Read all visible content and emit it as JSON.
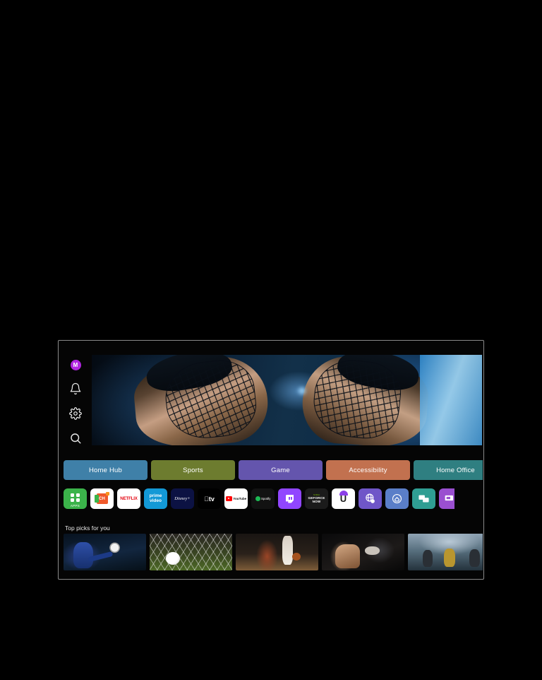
{
  "screen": {
    "device": "Smart TV Home Screen",
    "background_color": "#000000",
    "bezel_color": "#8c8c8c"
  },
  "sidebar": {
    "items": [
      {
        "name": "profile-avatar",
        "label": "M",
        "icon": "avatar-icon",
        "color": "#b026e0"
      },
      {
        "name": "notifications",
        "label": "",
        "icon": "bell-icon",
        "color": "#e6e6e6"
      },
      {
        "name": "settings",
        "label": "",
        "icon": "gear-icon",
        "color": "#e6e6e6"
      },
      {
        "name": "search",
        "label": "",
        "icon": "search-icon",
        "color": "#e6e6e6"
      }
    ]
  },
  "hero": {
    "name": "featured-banner",
    "description": "Two ice hockey players face off wearing caged helmets"
  },
  "tabs": [
    {
      "label": "Home Hub",
      "color": "#3f80a8"
    },
    {
      "label": "Sports",
      "color": "#6d7c2f"
    },
    {
      "label": "Game",
      "color": "#6455ad"
    },
    {
      "label": "Accessibility",
      "color": "#c2714f"
    },
    {
      "label": "Home Office",
      "color": "#2f7f81"
    }
  ],
  "apps": [
    {
      "label": "APPS",
      "icon": "apps-grid-icon",
      "bg": "#3bb34a",
      "kind": "apps"
    },
    {
      "label": "TV Channels",
      "icon": "tv-channels-icon",
      "bg": "#ffffff",
      "kind": "ch"
    },
    {
      "label": "NETFLIX",
      "icon": "netflix-icon",
      "bg": "#ffffff",
      "kind": "netflix"
    },
    {
      "label": "prime video",
      "icon": "prime-video-icon",
      "bg": "#1399d6",
      "kind": "prime"
    },
    {
      "label": "Disney+",
      "icon": "disney-plus-icon",
      "bg": "#0c1243",
      "kind": "disney"
    },
    {
      "label": "tv",
      "icon": "apple-tv-icon",
      "bg": "#000000",
      "kind": "atv"
    },
    {
      "label": "YouTube",
      "icon": "youtube-icon",
      "bg": "#ffffff",
      "kind": "yt"
    },
    {
      "label": "Spotify",
      "icon": "spotify-icon",
      "bg": "#121212",
      "kind": "spotify"
    },
    {
      "label": "Twitch",
      "icon": "twitch-icon",
      "bg": "#9146ff",
      "kind": "twitch"
    },
    {
      "label": "GEFORCE NOW",
      "icon": "geforce-now-icon",
      "bg": "#1b1b1b",
      "kind": "gfn"
    },
    {
      "label": "U",
      "icon": "u-app-icon",
      "bg": "#ffffff",
      "kind": "u"
    },
    {
      "label": "Internet",
      "icon": "globe-browser-icon",
      "bg": "#6f56c8",
      "kind": "globe"
    },
    {
      "label": "SmartThings",
      "icon": "smart-home-icon",
      "bg": "#5a7ec8",
      "kind": "home"
    },
    {
      "label": "Screen Share",
      "icon": "screen-mirroring-icon",
      "bg": "#2f9e93",
      "kind": "mirror"
    },
    {
      "label": "Workspace",
      "icon": "remote-pc-icon",
      "bg": "#9a4fd0",
      "kind": "pc"
    }
  ],
  "top_picks": {
    "title": "Top picks for you",
    "items": [
      {
        "name": "soccer-player-thumbnail",
        "alt": "Soccer player kicking ball"
      },
      {
        "name": "soccer-goal-thumbnail",
        "alt": "Soccer ball in goal net"
      },
      {
        "name": "basketball-thumbnail",
        "alt": "Basketball player dribbling"
      },
      {
        "name": "boxing-thumbnail",
        "alt": "Boxer punching"
      },
      {
        "name": "football-thumbnail",
        "alt": "American football players"
      }
    ]
  }
}
